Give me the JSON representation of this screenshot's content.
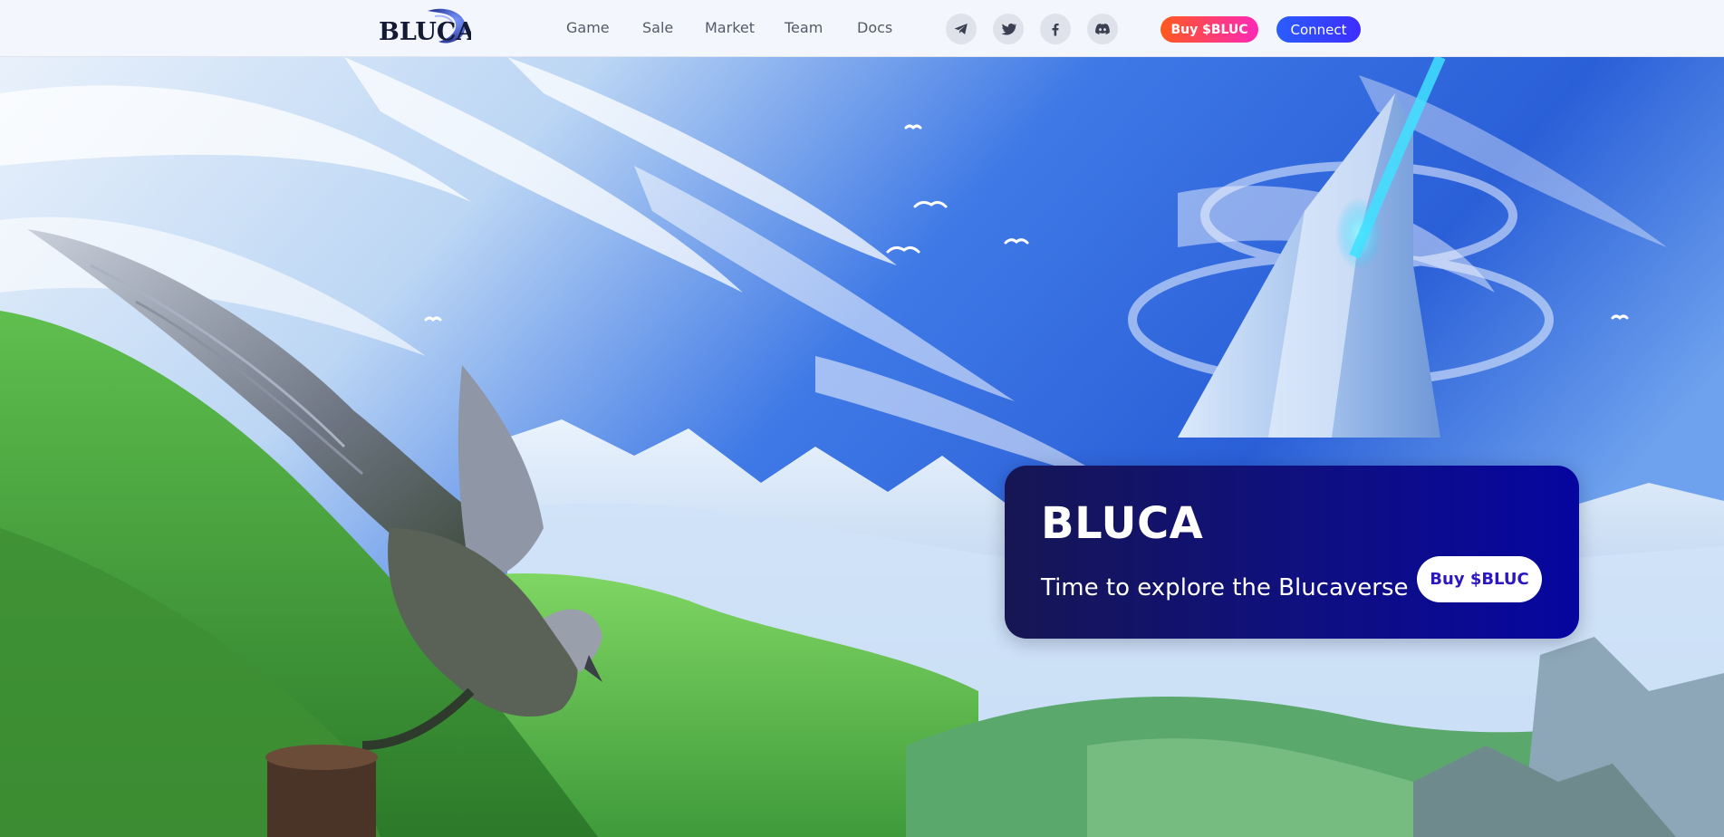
{
  "header": {
    "logo_text": "BLUCA",
    "nav": [
      {
        "label": "Game"
      },
      {
        "label": "Sale"
      },
      {
        "label": "Market"
      },
      {
        "label": "Team"
      },
      {
        "label": "Docs"
      }
    ],
    "social": [
      {
        "icon": "telegram-icon"
      },
      {
        "icon": "twitter-icon"
      },
      {
        "icon": "facebook-icon"
      },
      {
        "icon": "discord-icon"
      }
    ],
    "buy_label": "Buy $BLUC",
    "connect_label": "Connect"
  },
  "hero": {
    "title": "BLUCA",
    "subtitle": "Time to explore the Blucaverse",
    "cta_label": "Buy $BLUC"
  },
  "colors": {
    "card_start": "#161654",
    "card_end": "#0606a0",
    "buy_gradient_start": "#ff5a1c",
    "buy_gradient_end": "#ff29b7",
    "connect": "#2a5dff",
    "cta_text": "#2b16c4"
  }
}
